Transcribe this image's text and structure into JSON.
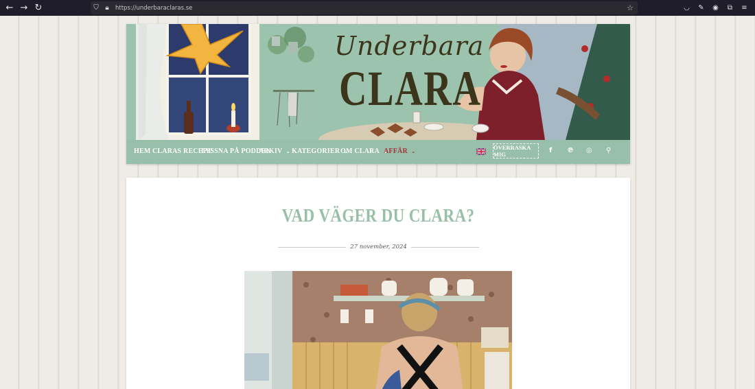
{
  "browser": {
    "url": "https://underbaraclaras.se",
    "nav_icons": [
      "back-arrow-icon",
      "forward-arrow-icon",
      "reload-icon"
    ],
    "tools": [
      "pocket-icon",
      "wrench-icon",
      "account-icon",
      "extensions-icon",
      "menu-icon"
    ]
  },
  "header": {
    "logo_script": "Underbara",
    "logo_main": "CLARA"
  },
  "nav": {
    "items": [
      {
        "label": "Hem",
        "has_dropdown": false
      },
      {
        "label": "Claras recept",
        "has_dropdown": false
      },
      {
        "label": "Lyssna på podden",
        "has_dropdown": false
      },
      {
        "label": "Arkiv",
        "has_dropdown": true
      },
      {
        "label": "Kategorier",
        "has_dropdown": true
      },
      {
        "label": "Om Clara",
        "has_dropdown": true
      },
      {
        "label": "Affär",
        "has_dropdown": true
      }
    ],
    "surprise_label": "Överraska mig",
    "social": [
      "facebook-icon",
      "pinterest-icon",
      "instagram-icon",
      "search-icon"
    ],
    "language_flag": "uk-flag-icon"
  },
  "post": {
    "title": "VAD VÄGER DU CLARA?",
    "date": "27 november, 2024"
  },
  "colors": {
    "accent": "#97bfa9",
    "shop": "#a4333b",
    "logo": "#3b351c"
  }
}
